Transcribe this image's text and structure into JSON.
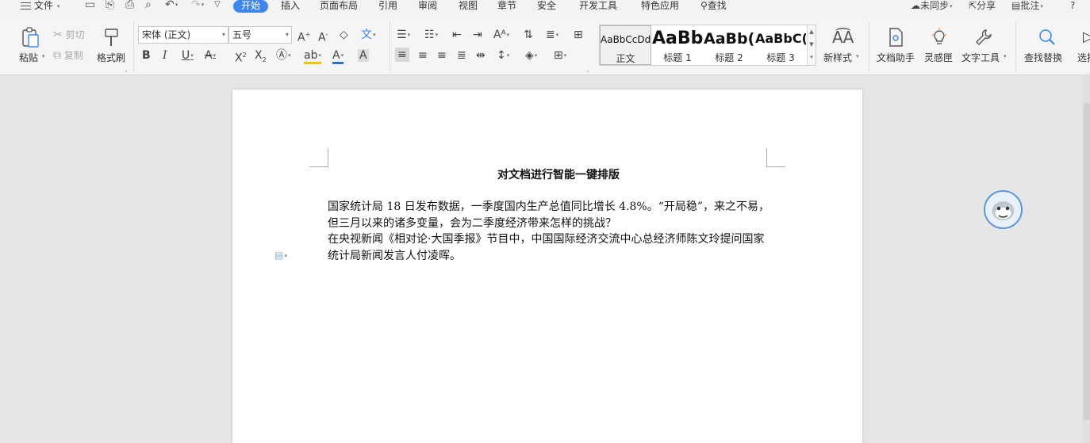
{
  "menubar": {
    "file": "文件",
    "tabs": [
      {
        "label": "开始"
      },
      {
        "label": "插入"
      },
      {
        "label": "页面布局"
      },
      {
        "label": "引用"
      },
      {
        "label": "审阅"
      },
      {
        "label": "视图"
      },
      {
        "label": "章节"
      },
      {
        "label": "安全"
      },
      {
        "label": "开发工具"
      },
      {
        "label": "特色应用"
      }
    ],
    "search": "查找",
    "sync": "未同步",
    "share": "分享",
    "comment": "批注",
    "help": "?"
  },
  "ribbon": {
    "clipboard": {
      "paste": "粘贴",
      "cut": "剪切",
      "copy": "复制",
      "format_painter": "格式刷"
    },
    "font": {
      "font_name": "宋体 (正文)",
      "font_size": "五号"
    },
    "styles": [
      {
        "preview": "AaBbCcDd",
        "name": "正文"
      },
      {
        "preview": "AaBb",
        "name": "标题 1"
      },
      {
        "preview": "AaBb(",
        "name": "标题 2"
      },
      {
        "preview": "AaBbC(",
        "name": "标题 3"
      }
    ],
    "new_style": "新样式",
    "doc_assistant": "文档助手",
    "inspiration": "灵感匣",
    "text_tools": "文字工具",
    "find_replace": "查找替换",
    "select": "选择"
  },
  "document": {
    "title": "对文档进行智能一键排版",
    "paragraphs": [
      "国家统计局 18 日发布数据，一季度国内生产总值同比增长 4.8%。“开局稳”，来之不易，但三月以来的诸多变量，会为二季度经济带来怎样的挑战？",
      "在央视新闻《相对论·大国季报》节目中，中国国际经济交流中心总经济师陈文玲提问国家统计局新闻发言人付凌晖。"
    ]
  },
  "colors": {
    "accent": "#3f86ea",
    "font_color_underline": "#2f6fd0",
    "highlight_underline": "#f0c400"
  }
}
